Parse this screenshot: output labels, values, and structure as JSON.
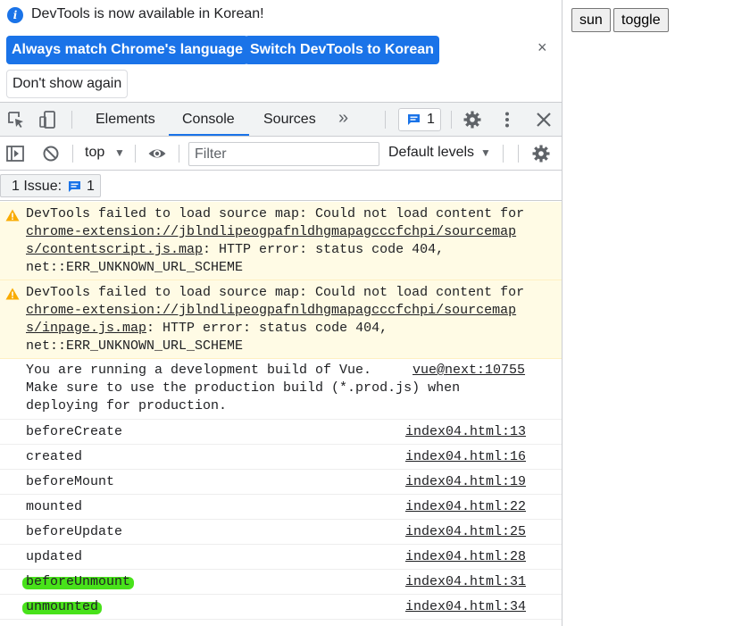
{
  "infobar": {
    "message": "DevTools is now available in Korean!",
    "btn_match": "Always match Chrome's language",
    "btn_switch": "Switch DevTools to Korean",
    "btn_dont_show": "Don't show again",
    "close_symbol": "×"
  },
  "tabs": {
    "elements": "Elements",
    "console": "Console",
    "sources": "Sources",
    "more": "»",
    "issues_count": "1"
  },
  "toolbar": {
    "context": "top",
    "filter_placeholder": "Filter",
    "levels": "Default levels"
  },
  "issues_bar": {
    "label": "1 Issue:",
    "count": "1"
  },
  "console": {
    "warnings": [
      {
        "prefix": "DevTools failed to load source map: Could not load content for ",
        "url_part1": "chrome-extension://jblndlipeogpafnldhgmapagcccfchpi/sourcemap",
        "url_part2": "s/contentscript.js.map",
        "suffix_line": ": HTTP error: status code 404,",
        "last_line": "net::ERR_UNKNOWN_URL_SCHEME"
      },
      {
        "prefix": "DevTools failed to load source map: Could not load content for ",
        "url_part1": "chrome-extension://jblndlipeogpafnldhgmapagcccfchpi/sourcemap",
        "url_part2": "s/inpage.js.map",
        "suffix_line": ": HTTP error: status code 404,",
        "last_line": "net::ERR_UNKNOWN_URL_SCHEME"
      }
    ],
    "vue_message": {
      "line1": "You are running a development build of Vue.",
      "line2": "Make sure to use the production build (*.prod.js) when",
      "line3": "deploying for production.",
      "source": "vue@next:10755"
    },
    "logs": [
      {
        "text": "beforeCreate",
        "source": "index04.html:13"
      },
      {
        "text": "created",
        "source": "index04.html:16"
      },
      {
        "text": "beforeMount",
        "source": "index04.html:19"
      },
      {
        "text": "mounted",
        "source": "index04.html:22"
      },
      {
        "text": "beforeUpdate",
        "source": "index04.html:25"
      },
      {
        "text": "updated",
        "source": "index04.html:28"
      },
      {
        "text": "beforeUnmount",
        "source": "index04.html:31"
      },
      {
        "text": "unmounted",
        "source": "index04.html:34"
      }
    ]
  },
  "page": {
    "btn_sun": "sun",
    "btn_toggle": "toggle"
  },
  "colors": {
    "accent": "#1a73e8",
    "warning_bg": "#fffbe5",
    "highlight": "#48e21a"
  }
}
